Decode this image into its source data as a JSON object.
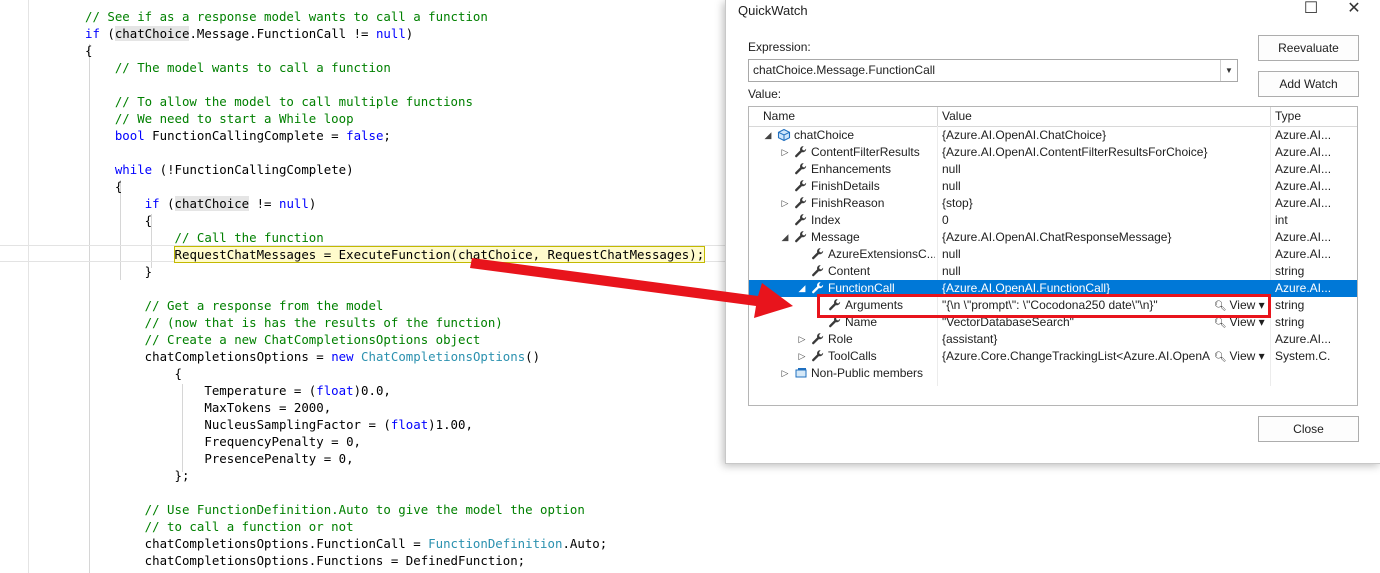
{
  "editor": {
    "lines": [
      {
        "segments": [
          {
            "t": "// See if as a response model wants to call a function",
            "c": "cmt"
          }
        ]
      },
      {
        "segments": [
          {
            "t": "if",
            "c": "kw"
          },
          {
            "t": " ("
          },
          {
            "t": "chatChoice",
            "c": "hl"
          },
          {
            "t": ".Message.FunctionCall != "
          },
          {
            "t": "null",
            "c": "kw"
          },
          {
            "t": ")"
          }
        ]
      },
      {
        "segments": [
          {
            "t": "{"
          }
        ]
      },
      {
        "segments": [
          {
            "t": "    // The model wants to call a function",
            "c": "cmt"
          }
        ]
      },
      {
        "segments": [
          {
            "t": ""
          }
        ]
      },
      {
        "segments": [
          {
            "t": "    // To allow the model to call multiple functions",
            "c": "cmt"
          }
        ]
      },
      {
        "segments": [
          {
            "t": "    // We need to start a While loop",
            "c": "cmt"
          }
        ]
      },
      {
        "segments": [
          {
            "t": "    "
          },
          {
            "t": "bool",
            "c": "kw"
          },
          {
            "t": " FunctionCallingComplete = "
          },
          {
            "t": "false",
            "c": "kw"
          },
          {
            "t": ";"
          }
        ]
      },
      {
        "segments": [
          {
            "t": ""
          }
        ]
      },
      {
        "segments": [
          {
            "t": "    "
          },
          {
            "t": "while",
            "c": "kw"
          },
          {
            "t": " (!FunctionCallingComplete)"
          }
        ]
      },
      {
        "segments": [
          {
            "t": "    {"
          }
        ]
      },
      {
        "segments": [
          {
            "t": "        "
          },
          {
            "t": "if",
            "c": "kw"
          },
          {
            "t": " ("
          },
          {
            "t": "chatChoice",
            "c": "hl"
          },
          {
            "t": " != "
          },
          {
            "t": "null",
            "c": "kw"
          },
          {
            "t": ")"
          }
        ]
      },
      {
        "segments": [
          {
            "t": "        {"
          }
        ]
      },
      {
        "segments": [
          {
            "t": "            // Call the function",
            "c": "cmt"
          }
        ]
      },
      {
        "segments": [
          {
            "t": "            "
          },
          {
            "t": "RequestChatMessages = ExecuteFunction(chatChoice, RequestChatMessages);",
            "c": "sel"
          }
        ]
      },
      {
        "segments": [
          {
            "t": "        }"
          }
        ]
      },
      {
        "segments": [
          {
            "t": ""
          }
        ]
      },
      {
        "segments": [
          {
            "t": "        // Get a response from the model",
            "c": "cmt"
          }
        ]
      },
      {
        "segments": [
          {
            "t": "        // (now that is has the results of the function)",
            "c": "cmt"
          }
        ]
      },
      {
        "segments": [
          {
            "t": "        // Create a new ChatCompletionsOptions object",
            "c": "cmt"
          }
        ]
      },
      {
        "segments": [
          {
            "t": "        chatCompletionsOptions = "
          },
          {
            "t": "new",
            "c": "kw"
          },
          {
            "t": " "
          },
          {
            "t": "ChatCompletionsOptions",
            "c": "typ"
          },
          {
            "t": "()"
          }
        ]
      },
      {
        "segments": [
          {
            "t": "            {"
          }
        ]
      },
      {
        "segments": [
          {
            "t": "                Temperature = ("
          },
          {
            "t": "float",
            "c": "kw"
          },
          {
            "t": ")0.0,"
          }
        ]
      },
      {
        "segments": [
          {
            "t": "                MaxTokens = 2000,"
          }
        ]
      },
      {
        "segments": [
          {
            "t": "                NucleusSamplingFactor = ("
          },
          {
            "t": "float",
            "c": "kw"
          },
          {
            "t": ")1.00,"
          }
        ]
      },
      {
        "segments": [
          {
            "t": "                FrequencyPenalty = 0,"
          }
        ]
      },
      {
        "segments": [
          {
            "t": "                PresencePenalty = 0,"
          }
        ]
      },
      {
        "segments": [
          {
            "t": "            };"
          }
        ]
      },
      {
        "segments": [
          {
            "t": ""
          }
        ]
      },
      {
        "segments": [
          {
            "t": "        // Use FunctionDefinition.Auto to give the model the option",
            "c": "cmt"
          }
        ]
      },
      {
        "segments": [
          {
            "t": "        // to call a function or not",
            "c": "cmt"
          }
        ]
      },
      {
        "segments": [
          {
            "t": "        chatCompletionsOptions.FunctionCall = "
          },
          {
            "t": "FunctionDefinition",
            "c": "typ"
          },
          {
            "t": ".Auto;"
          }
        ]
      },
      {
        "segments": [
          {
            "t": "        chatCompletionsOptions.Functions = DefinedFunction;"
          }
        ]
      }
    ]
  },
  "quickwatch": {
    "title": "QuickWatch",
    "minimize_glyph": "☐",
    "close_glyph": "✕",
    "expression_label": "Expression:",
    "expression_value": "chatChoice.Message.FunctionCall",
    "value_label": "Value:",
    "reevaluate_label": "Reevaluate",
    "add_watch_label": "Add Watch",
    "close_label": "Close",
    "columns": {
      "name": "Name",
      "value": "Value",
      "type": "Type"
    },
    "rows": [
      {
        "level": 0,
        "exp": "◢",
        "icon": "object-icon",
        "name": "chatChoice",
        "value": "{Azure.AI.OpenAI.ChatChoice}",
        "type": "Azure.AI...."
      },
      {
        "level": 1,
        "exp": "▷",
        "icon": "wrench-icon",
        "name": "ContentFilterResults",
        "value": "{Azure.AI.OpenAI.ContentFilterResultsForChoice}",
        "type": "Azure.AI...."
      },
      {
        "level": 1,
        "exp": "",
        "icon": "wrench-icon",
        "name": "Enhancements",
        "value": "null",
        "type": "Azure.AI...."
      },
      {
        "level": 1,
        "exp": "",
        "icon": "wrench-icon",
        "name": "FinishDetails",
        "value": "null",
        "type": "Azure.AI...."
      },
      {
        "level": 1,
        "exp": "▷",
        "icon": "wrench-icon",
        "name": "FinishReason",
        "value": "{stop}",
        "type": "Azure.AI...."
      },
      {
        "level": 1,
        "exp": "",
        "icon": "wrench-icon",
        "name": "Index",
        "value": "0",
        "type": "int"
      },
      {
        "level": 1,
        "exp": "◢",
        "icon": "wrench-icon",
        "name": "Message",
        "value": "{Azure.AI.OpenAI.ChatResponseMessage}",
        "type": "Azure.AI...."
      },
      {
        "level": 2,
        "exp": "",
        "icon": "wrench-icon",
        "name": "AzureExtensionsC...",
        "value": "null",
        "type": "Azure.AI...."
      },
      {
        "level": 2,
        "exp": "",
        "icon": "wrench-icon",
        "name": "Content",
        "value": "null",
        "type": "string"
      },
      {
        "level": 2,
        "exp": "◢",
        "icon": "wrench-icon",
        "name": "FunctionCall",
        "value": "{Azure.AI.OpenAI.FunctionCall}",
        "type": "Azure.AI....",
        "selected": true
      },
      {
        "level": 3,
        "exp": "",
        "icon": "wrench-icon",
        "name": "Arguments",
        "value": "\"{\\n \\\"prompt\\\": \\\"Cocodona250 date\\\"\\n}\"",
        "type": "string",
        "view": "View"
      },
      {
        "level": 3,
        "exp": "",
        "icon": "wrench-icon",
        "name": "Name",
        "value": "\"VectorDatabaseSearch\"",
        "type": "string",
        "view": "View"
      },
      {
        "level": 2,
        "exp": "▷",
        "icon": "wrench-icon",
        "name": "Role",
        "value": "{assistant}",
        "type": "Azure.AI...."
      },
      {
        "level": 2,
        "exp": "▷",
        "icon": "wrench-icon",
        "name": "ToolCalls",
        "value": "{Azure.Core.ChangeTrackingList<Azure.AI.OpenA...",
        "type": "System.C....",
        "view": "View"
      },
      {
        "level": 1,
        "exp": "▷",
        "icon": "members-icon",
        "name": "Non-Public members",
        "value": "",
        "type": ""
      }
    ]
  },
  "colors": {
    "accent": "#0078d7",
    "annotation": "#e8141c",
    "comment": "#008000",
    "keyword": "#0000ff",
    "type": "#2b91af"
  }
}
